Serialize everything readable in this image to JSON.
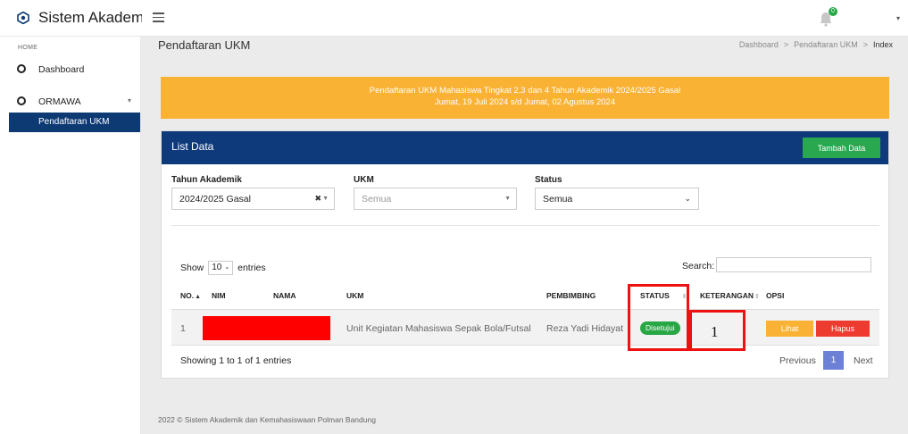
{
  "app": {
    "title": "Sistem Akademik"
  },
  "header": {
    "notification_count": "0"
  },
  "sidebar": {
    "section": "HOME",
    "items": [
      {
        "label": "Dashboard"
      },
      {
        "label": "ORMAWA"
      }
    ],
    "active_sub": "Pendaftaran UKM"
  },
  "page": {
    "title": "Pendaftaran UKM",
    "breadcrumb": [
      "Dashboard",
      "Pendaftaran UKM",
      "Index"
    ]
  },
  "banner": {
    "line1": "Pendaftaran UKM Mahasiswa Tingkat 2,3 dan 4 Tahun Akademik 2024/2025 Gasal",
    "line2": "Jumat, 19 Juli 2024 s/d Jumat, 02 Agustus 2024"
  },
  "card": {
    "title": "List Data",
    "add_button": "Tambah Data"
  },
  "filters": {
    "tahun": {
      "label": "Tahun Akademik",
      "value": "2024/2025 Gasal"
    },
    "ukm": {
      "label": "UKM",
      "placeholder": "Semua"
    },
    "status": {
      "label": "Status",
      "value": "Semua"
    }
  },
  "table": {
    "show_label": "Show",
    "entries_value": "10",
    "entries_label": "entries",
    "search_label": "Search:",
    "headers": {
      "no": "NO.",
      "nim": "NIM",
      "nama": "NAMA",
      "ukm": "UKM",
      "pembimbing": "PEMBIMBING",
      "status": "STATUS",
      "keterangan": "KETERANGAN",
      "opsi": "OPSI"
    },
    "rows": [
      {
        "no": "1",
        "ukm": "Unit Kegiatan Mahasiswa Sepak Bola/Futsal",
        "pembimbing": "Reza Yadi Hidayat",
        "status": "Disetujui",
        "keterangan": "",
        "btn_view": "Lihat",
        "btn_delete": "Hapus"
      }
    ],
    "info": "Showing 1 to 1 of 1 entries",
    "pagination": {
      "prev": "Previous",
      "page": "1",
      "next": "Next"
    }
  },
  "annotation": {
    "label": "1",
    "color": "#e11111"
  },
  "footer": "2022 © Sistem Akademik dan Kemahasiswaan Polman Bandung",
  "colors": {
    "primary": "#0e3a7c",
    "warning": "#f9b234",
    "success": "#28a745",
    "danger": "#ee3b2f",
    "pagination": "#6c80d6"
  }
}
